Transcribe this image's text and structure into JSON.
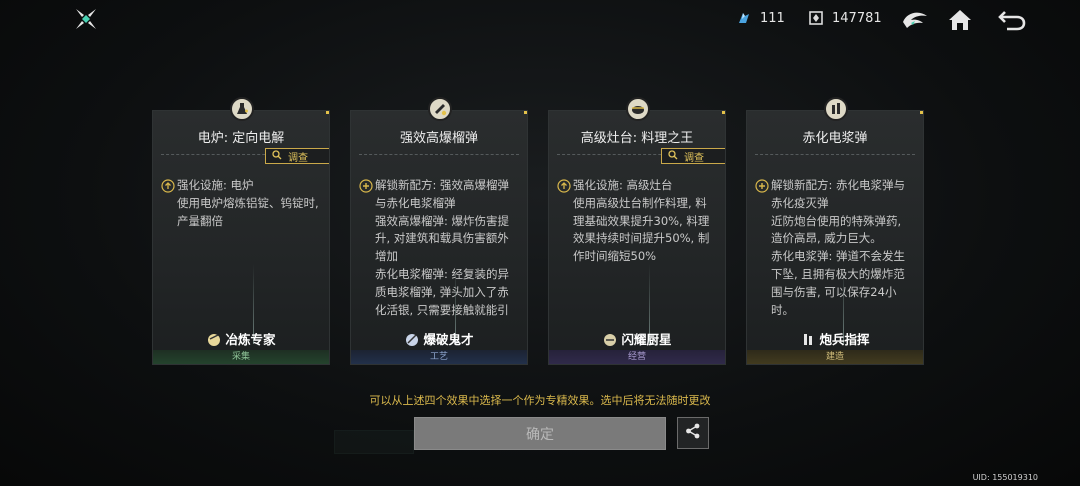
{
  "top": {
    "resource1_value": "111",
    "resource2_value": "147781"
  },
  "cards": [
    {
      "title": "电炉: 定向电解",
      "has_investigate": true,
      "paragraphs": [
        {
          "icon": "arrow-up-icon",
          "text": "强化设施: 电炉\n使用电炉熔炼铝锭、钨锭时, 产量翻倍"
        }
      ],
      "perk": "冶炼专家",
      "category": "采集",
      "category_color": "#8fc498"
    },
    {
      "title": "强效高爆榴弹",
      "has_investigate": false,
      "paragraphs": [
        {
          "icon": "plus-icon",
          "text": "解锁新配方: 强效高爆榴弹与赤化电浆榴弹\n强效高爆榴弹: 爆炸伤害提升, 对建筑和载具伤害额外增加\n赤化电浆榴弹: 经复装的异质电浆榴弹, 弹头加入了赤化活银, 只需要接触就能引发小规模的溶解现象, 会大"
        }
      ],
      "perk": "爆破鬼才",
      "category": "工艺",
      "category_color": "#8fa6cf"
    },
    {
      "title": "高级灶台: 料理之王",
      "has_investigate": true,
      "paragraphs": [
        {
          "icon": "arrow-up-icon",
          "text": "强化设施: 高级灶台\n使用高级灶台制作料理, 料理基础效果提升30%, 料理效果持续时间提升50%, 制作时间缩短50%"
        }
      ],
      "perk": "闪耀厨星",
      "category": "经营",
      "category_color": "#a99bd0"
    },
    {
      "title": "赤化电浆弹",
      "has_investigate": false,
      "paragraphs": [
        {
          "icon": "plus-icon",
          "text": "解锁新配方: 赤化电浆弹与赤化疫灭弹\n近防炮台使用的特殊弹药, 造价高昂, 威力巨大。\n赤化电浆弹: 弹道不会发生下坠, 且拥有极大的爆炸范围与伤害, 可以保存24小时。\n赤化疫灭弹: 可以对感染者"
        }
      ],
      "perk": "炮兵指挥",
      "category": "建造",
      "category_color": "#d1bd7a"
    }
  ],
  "investigate_label": "调查",
  "hint": "可以从上述四个效果中选择一个作为专精效果。选中后将无法随时更改",
  "confirm_label": "确定",
  "uid": "UID: 155019310",
  "colors": {
    "accent_gold": "#d9b84c",
    "confirm_bg": "#7a7a7a"
  }
}
